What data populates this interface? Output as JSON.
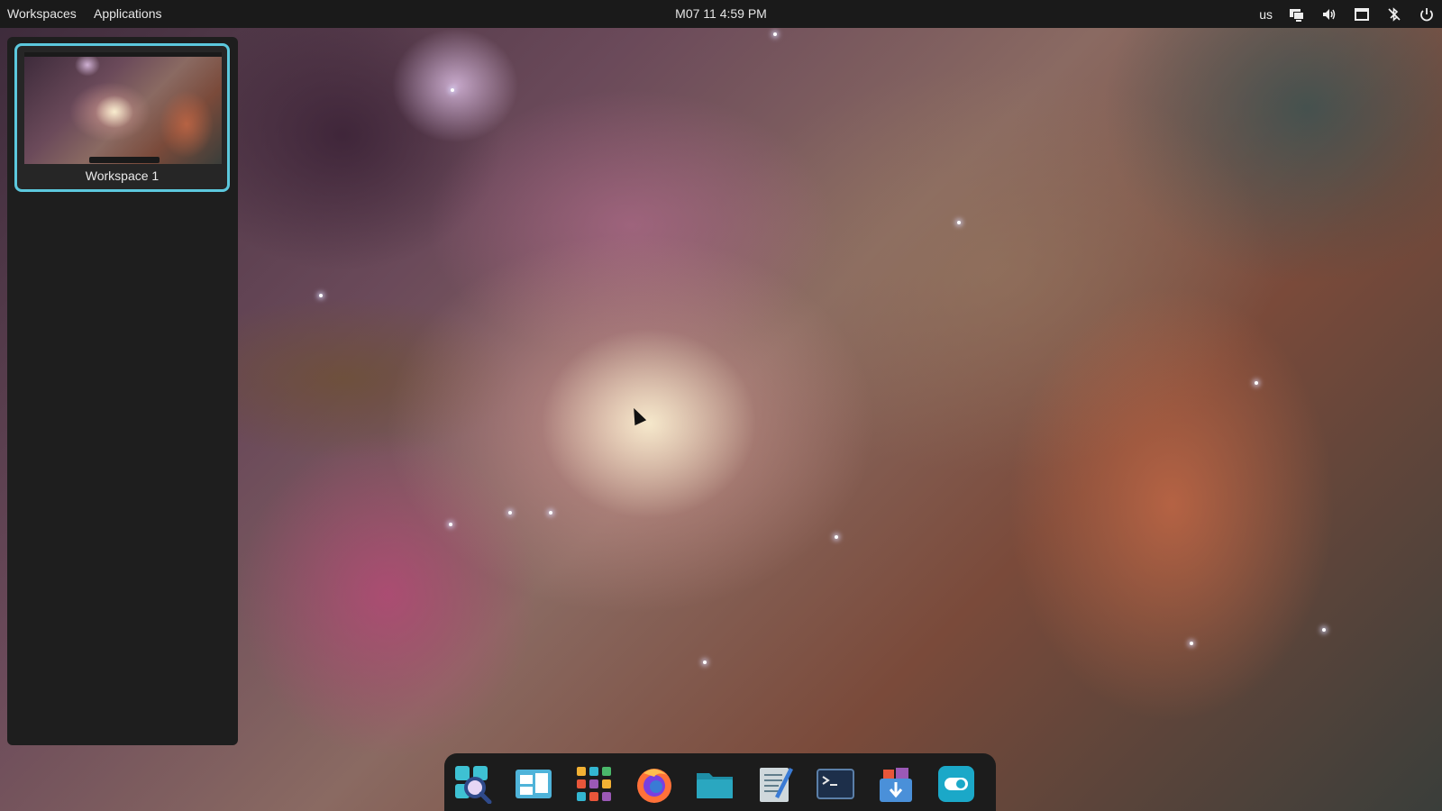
{
  "topbar": {
    "workspaces_label": "Workspaces",
    "applications_label": "Applications",
    "clock": "M07 11 4:59 PM",
    "keyboard_layout": "us",
    "tray_icons": [
      "display-icon",
      "volume-icon",
      "screenshot-icon",
      "bluetooth-off-icon",
      "power-icon"
    ]
  },
  "workspaces": [
    {
      "label": "Workspace 1",
      "active": true
    }
  ],
  "dock": {
    "items": [
      {
        "name": "search-app-icon",
        "color": "#3ec1d3"
      },
      {
        "name": "window-manager-icon",
        "color": "#4fb3d9"
      },
      {
        "name": "app-grid-icon",
        "color": "#f0a030"
      },
      {
        "name": "firefox-icon",
        "color": "#ff7139"
      },
      {
        "name": "files-folder-icon",
        "color": "#2aa7c0"
      },
      {
        "name": "text-editor-icon",
        "color": "#cfd8dc"
      },
      {
        "name": "terminal-icon",
        "color": "#1d2f4a"
      },
      {
        "name": "installer-icon",
        "color": "#4a90d9"
      },
      {
        "name": "settings-toggle-icon",
        "color": "#1ba8c8"
      }
    ]
  },
  "colors": {
    "accent": "#5cc8dd",
    "panel_bg": "#1e1e1e",
    "topbar_bg": "#1a1a1a"
  }
}
